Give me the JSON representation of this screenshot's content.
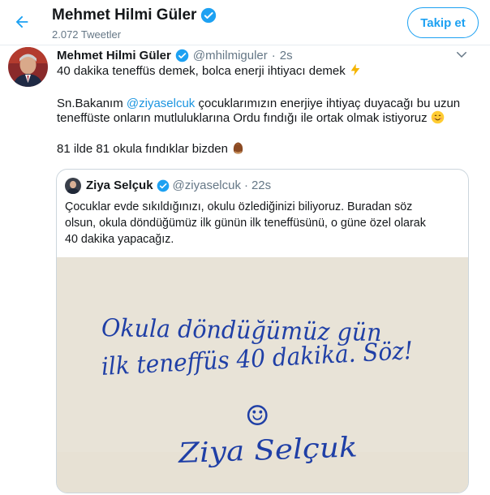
{
  "header": {
    "name": "Mehmet Hilmi Güler",
    "tweet_count": "2.072 Tweetler",
    "follow_label": "Takip et"
  },
  "tweet": {
    "name": "Mehmet Hilmi Güler",
    "handle": "@mhilmiguler",
    "separator": "·",
    "time": "2s",
    "line1": "40 dakika teneffüs demek, bolca enerji ihtiyacı demek",
    "line2_pre": "Sn.Bakanım ",
    "line2_mention": "@ziyaselcuk",
    "line2_post": " çocuklarımızın enerjiye ihtiyaç duyacağı bu uzun",
    "line3": "teneffüste onların mutluluklarına Ordu fındığı ile ortak olmak istiyoruz",
    "line4": "81 ilde 81 okula fındıklar bizden"
  },
  "quote": {
    "name": "Ziya Selçuk",
    "handle": "@ziyaselcuk",
    "separator": "·",
    "time": "22s",
    "line1": "Çocuklar evde sıkıldığınızı, okulu özlediğinizi biliyoruz. Buradan söz",
    "line2": "olsun, okula döndüğümüz ilk günün ilk teneffüsünü, o güne özel olarak",
    "line3": "40 dakika yapacağız.",
    "image_line1": "Okula döndüğümüz gün",
    "image_line2": "ilk teneffüs 40 dakika. Söz!",
    "image_smiley": "☺",
    "image_signature": "Ziya Selçuk"
  },
  "icons": {
    "back": "arrow-left-icon",
    "verified": "verified-badge-icon",
    "caret": "chevron-down-icon",
    "lightning": "lightning-emoji",
    "smile": "smiling-face-emoji",
    "hazelnut": "hazelnut-emoji"
  },
  "colors": {
    "accent": "#1da1f2",
    "mention": "#1b95e0",
    "text": "#14171a",
    "secondary": "#657786",
    "border": "#e6ecf0",
    "ink": "#1f3fa6",
    "paper": "#ece6dc"
  }
}
